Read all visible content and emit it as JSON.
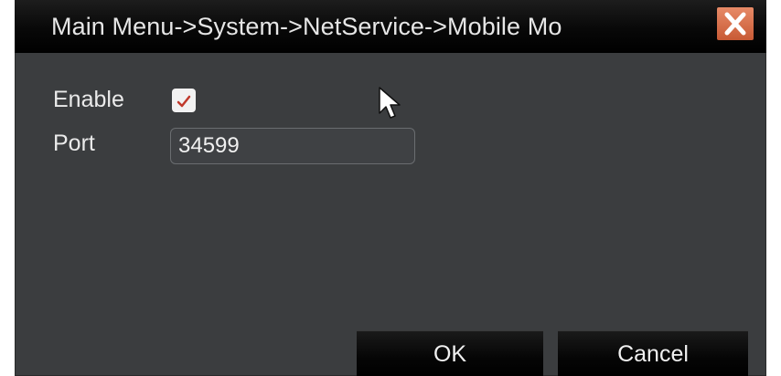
{
  "window": {
    "title": "Main Menu->System->NetService->Mobile Mo",
    "close_icon": "close-icon"
  },
  "form": {
    "enable_label": "Enable",
    "enable_checked": true,
    "port_label": "Port",
    "port_value": "34599"
  },
  "buttons": {
    "ok_label": "OK",
    "cancel_label": "Cancel"
  },
  "colors": {
    "panel_background": "#3b3d3f",
    "title_bar": "#000000",
    "close_button": "#d9693f",
    "check_mark": "#c0392b",
    "text": "#eaeaea"
  }
}
